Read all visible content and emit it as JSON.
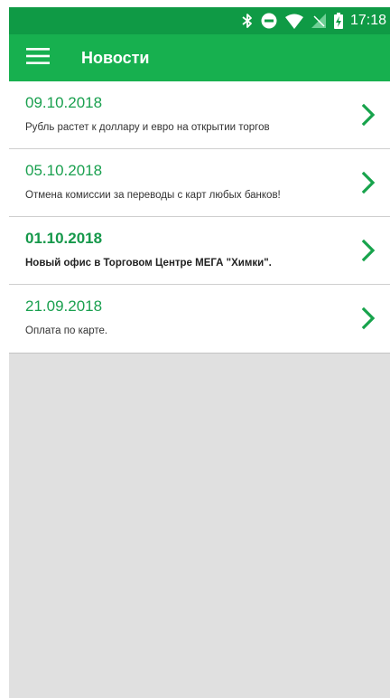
{
  "status_bar": {
    "time": "17:18",
    "icons": [
      "bluetooth-icon",
      "do-not-disturb-icon",
      "wifi-icon",
      "no-signal-icon",
      "battery-charging-icon"
    ]
  },
  "app_bar": {
    "title": "Новости",
    "menu_icon": "hamburger-menu-icon"
  },
  "news": [
    {
      "date": "09.10.2018",
      "title": "Рубль растет к доллару и евро на открытии торгов",
      "unread": false
    },
    {
      "date": "05.10.2018",
      "title": "Отмена комиссии за переводы с карт любых банков!",
      "unread": false
    },
    {
      "date": "01.10.2018",
      "title": "Новый офис в Торговом Центре МЕГА \"Химки\".",
      "unread": true
    },
    {
      "date": "21.09.2018",
      "title": "Оплата по карте.",
      "unread": false
    }
  ],
  "colors": {
    "status_bar": "#0f9a45",
    "app_bar": "#17b04f",
    "accent": "#1aa04f",
    "background": "#e0e0e0"
  }
}
